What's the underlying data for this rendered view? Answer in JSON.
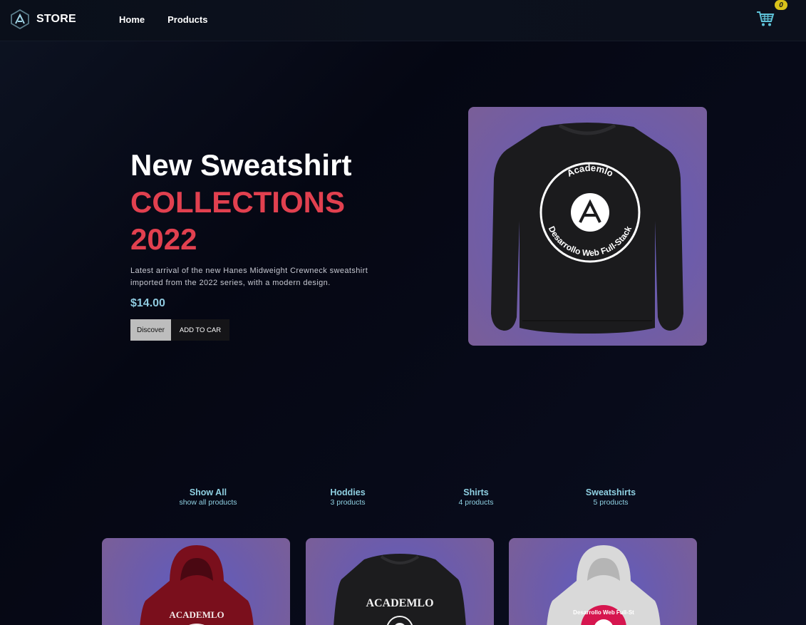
{
  "header": {
    "brand": "STORE",
    "nav": [
      "Home",
      "Products"
    ],
    "cart_count": "0"
  },
  "hero": {
    "title_line1": "New Sweatshirt",
    "title_line2": "COLLECTIONS",
    "title_line3": "2022",
    "description": "Latest arrival of the new Hanes Midweight Crewneck sweatshirt imported from the 2022 series, with a modern design.",
    "price": "$14.00",
    "discover_label": "Discover",
    "add_label": "ADD TO CAR",
    "product_print": {
      "top": "Academlo",
      "bottom": "Desarrollo Web Full-Stack"
    }
  },
  "filters": [
    {
      "name": "Show All",
      "count": "show all products"
    },
    {
      "name": "Hoddies",
      "count": "3 products"
    },
    {
      "name": "Shirts",
      "count": "4 products"
    },
    {
      "name": "Sweatshirts",
      "count": "5 products"
    }
  ],
  "products": [
    {
      "color": "#7a0f1c",
      "kind": "hoodie",
      "print": "ACADEMLO"
    },
    {
      "color": "#1c1c1e",
      "kind": "sweatshirt",
      "print": "ACADEMLO"
    },
    {
      "color": "#d9d9d9",
      "kind": "hoodie",
      "print": "Desarrollo Web Full-St"
    }
  ],
  "colors": {
    "accent_red": "#e1404f",
    "accent_cyan": "#8fd0e2",
    "badge_yellow": "#d9c21a"
  }
}
